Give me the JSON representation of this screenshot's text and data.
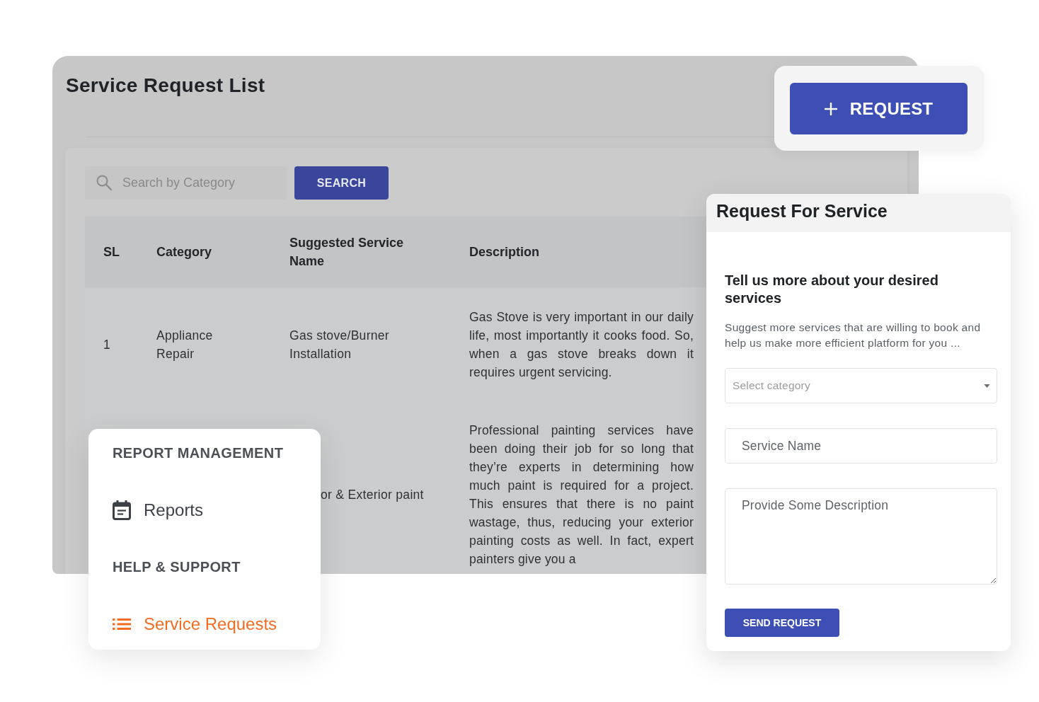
{
  "page": {
    "title": "Service Request List"
  },
  "search": {
    "placeholder": "Search by Category",
    "button": "SEARCH"
  },
  "table": {
    "columns": [
      "SL",
      "Category",
      "Suggested Service Name",
      "Description"
    ],
    "rows": [
      {
        "sl": "1",
        "category": "Appliance Repair",
        "service": "Gas stove/Burner Installation",
        "description": "Gas Stove is very important in our daily life, most importantly it cooks food. So, when a gas stove breaks down it requires urgent servicing."
      },
      {
        "service": "or & Exterior paint",
        "description": "Professional painting services have been doing their job for so long that they’re experts in determining how much paint is required for a project. This ensures that there is no paint wastage, thus, reducing your exterior painting costs as well. In fact, expert painters give you a"
      }
    ]
  },
  "request_button": {
    "label": "REQUEST"
  },
  "sidebar": {
    "sections": [
      {
        "heading": "REPORT MANAGEMENT",
        "items": [
          {
            "label": "Reports",
            "selected": false
          }
        ]
      },
      {
        "heading": "HELP & SUPPORT",
        "items": [
          {
            "label": "Service Requests",
            "selected": true
          }
        ]
      }
    ]
  },
  "form": {
    "title": "Request For Service",
    "heading": "Tell us more about your desired services",
    "intro": "Suggest more services that are willing to book and help us make more efficient platform for you ...",
    "category_select": {
      "placeholder": "Select category"
    },
    "service_name": {
      "placeholder": "Service Name"
    },
    "description": {
      "placeholder": "Provide Some Description"
    },
    "submit": "SEND REQUEST"
  }
}
